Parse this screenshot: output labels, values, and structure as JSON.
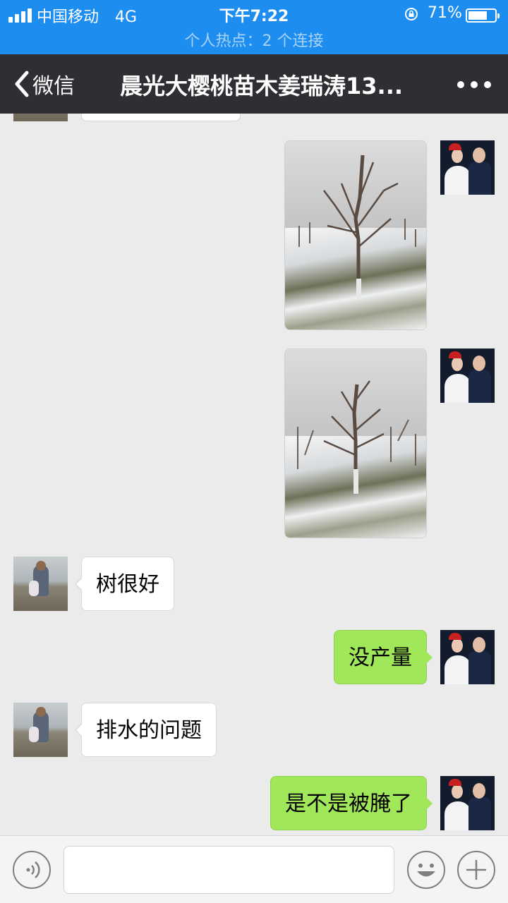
{
  "status_bar": {
    "carrier": "中国移动",
    "network": "4G",
    "time": "下午7:22",
    "battery_percent": "71%",
    "battery_level": 0.71,
    "hotspot": "个人热点：2 个连接"
  },
  "nav": {
    "back_label": "微信",
    "title": "晨光大樱桃苗木姜瑞涛13..."
  },
  "messages": [
    {
      "side": "right",
      "type": "image",
      "icon": "photo-snowy-cherry-orchard"
    },
    {
      "side": "right",
      "type": "image",
      "icon": "photo-snowy-cherry-orchard"
    },
    {
      "side": "left",
      "type": "text",
      "text": "树很好"
    },
    {
      "side": "right",
      "type": "text",
      "text": "没产量"
    },
    {
      "side": "left",
      "type": "text",
      "text": "排水的问题"
    },
    {
      "side": "right",
      "type": "text",
      "text": "是不是被腌了"
    }
  ],
  "input_bar": {
    "voice_icon": "voice-icon",
    "emoji_icon": "emoji-icon",
    "plus_icon": "plus-icon",
    "input_value": ""
  }
}
